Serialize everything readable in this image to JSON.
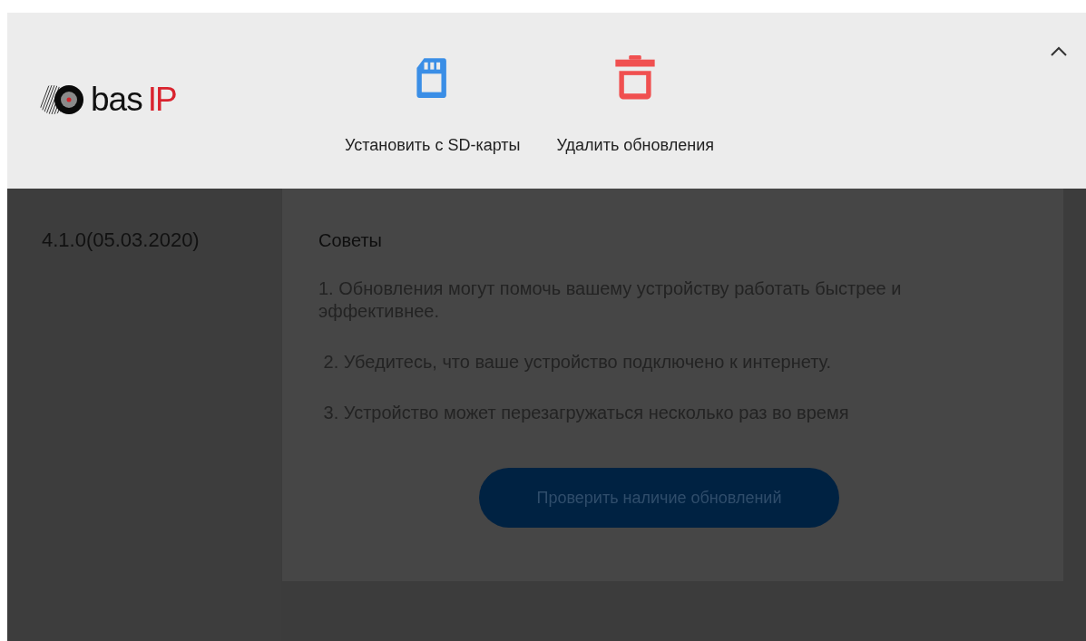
{
  "header": {
    "logo": {
      "word": "bas",
      "accent": "IP"
    },
    "actions": [
      {
        "kind": "sd-card",
        "label": "Установить с SD-карты"
      },
      {
        "kind": "delete",
        "label": "Удалить обновления"
      }
    ],
    "expanded": true
  },
  "sidebar": {
    "version": "4.1.0(05.03.2020)"
  },
  "content": {
    "title": "Советы",
    "tips": [
      "1. Обновления могут помочь вашему устройству работать быстрее и эффективнее.",
      " 2. Убедитесь, что ваше устройство подключено к интернету.",
      " 3. Устройство может перезагружаться несколько раз во время"
    ],
    "check_button": "Проверить наличие обновлений"
  }
}
